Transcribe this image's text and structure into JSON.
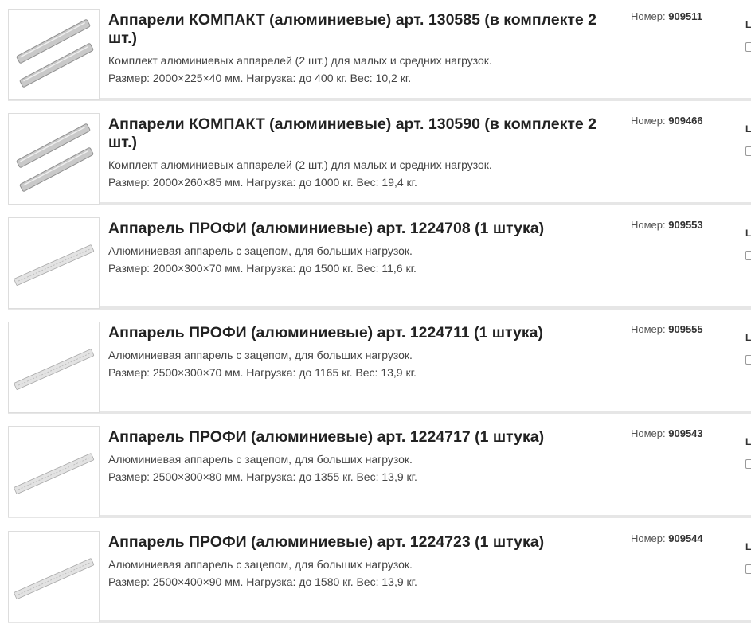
{
  "products": [
    {
      "title": "Аппарели КОМПАКТ (алюминиевые) арт. 130585 (в комплекте 2 шт.)",
      "desc": "Комплект алюминиевых аппарелей (2 шт.) для малых и средних нагрузок.",
      "specs": "Размер: 2000×225×40 мм. Нагрузка: до 400 кг. Вес: 10,2 кг.",
      "number_label": "Номер:",
      "number": "909511",
      "side_label": "L",
      "image": "pair"
    },
    {
      "title": "Аппарели КОМПАКТ (алюминиевые) арт. 130590 (в комплекте 2 шт.)",
      "desc": "Комплект алюминиевых аппарелей (2 шт.) для малых и средних нагрузок.",
      "specs": "Размер: 2000×260×85 мм. Нагрузка: до 1000 кг. Вес: 19,4 кг.",
      "number_label": "Номер:",
      "number": "909466",
      "side_label": "L",
      "image": "pair"
    },
    {
      "title": "Аппарель ПРОФИ (алюминиевые) арт. 1224708 (1 штука)",
      "desc": "Алюминиевая аппарель с зацепом, для больших нагрузок.",
      "specs": "Размер: 2000×300×70 мм. Нагрузка: до 1500 кг. Вес: 11,6 кг.",
      "number_label": "Номер:",
      "number": "909553",
      "side_label": "L",
      "image": "single"
    },
    {
      "title": "Аппарель ПРОФИ (алюминиевые) арт. 1224711 (1 штука)",
      "desc": "Алюминиевая аппарель с зацепом, для больших нагрузок.",
      "specs": "Размер: 2500×300×70 мм. Нагрузка: до 1165 кг. Вес: 13,9 кг.",
      "number_label": "Номер:",
      "number": "909555",
      "side_label": "L",
      "image": "single"
    },
    {
      "title": "Аппарель ПРОФИ (алюминиевые) арт. 1224717 (1 штука)",
      "desc": "Алюминиевая аппарель с зацепом, для больших нагрузок.",
      "specs": "Размер: 2500×300×80 мм. Нагрузка: до 1355 кг. Вес: 13,9 кг.",
      "number_label": "Номер:",
      "number": "909543",
      "side_label": "L",
      "image": "single"
    },
    {
      "title": "Аппарель ПРОФИ (алюминиевые) арт. 1224723 (1 штука)",
      "desc": "Алюминиевая аппарель с зацепом, для больших нагрузок.",
      "specs": "Размер: 2500×400×90 мм. Нагрузка: до 1580 кг. Вес: 13,9 кг.",
      "number_label": "Номер:",
      "number": "909544",
      "side_label": "L",
      "image": "single"
    }
  ],
  "colors": {
    "title": "#222222",
    "text": "#444444",
    "separator": "#e6e6e6",
    "border": "#dddddd"
  }
}
